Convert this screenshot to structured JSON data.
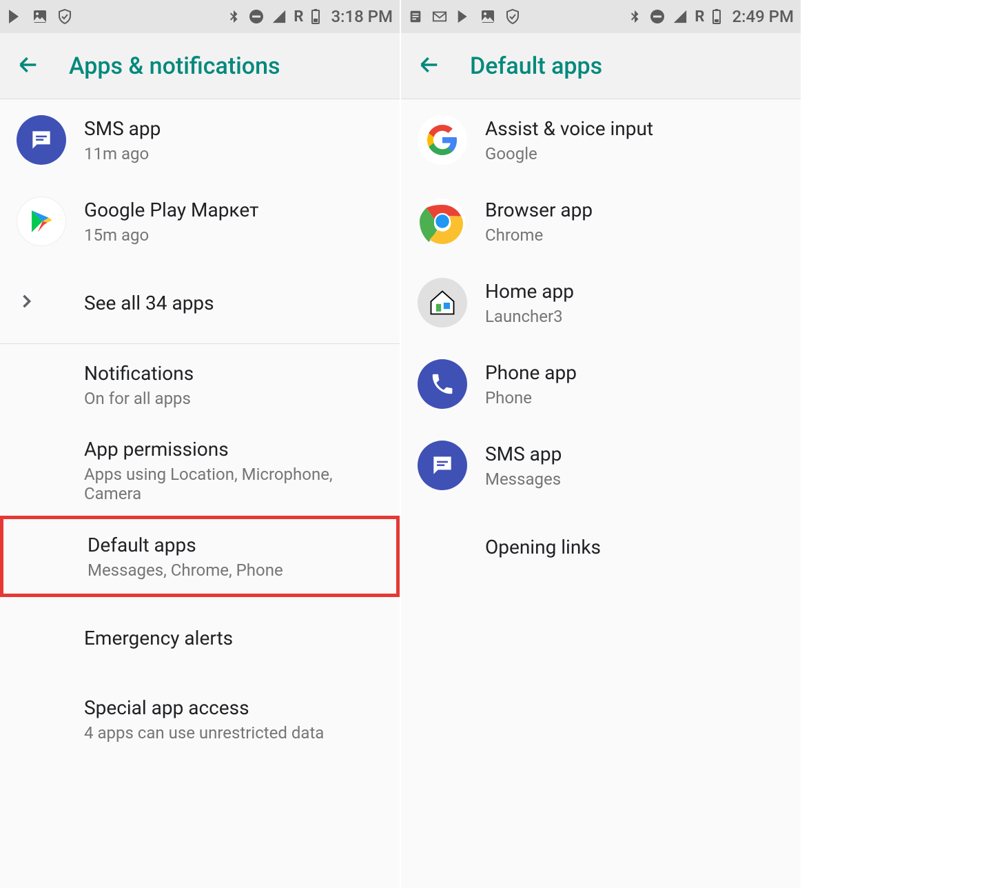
{
  "left": {
    "status": {
      "time": "3:18 PM",
      "network_label": "R"
    },
    "header": {
      "title": "Apps & notifications"
    },
    "items": [
      {
        "title": "SMS app",
        "subtitle": "11m ago"
      },
      {
        "title": "Google Play Маркет",
        "subtitle": "15m ago"
      },
      {
        "title": "See all 34 apps"
      },
      {
        "title": "Notifications",
        "subtitle": "On for all apps"
      },
      {
        "title": "App permissions",
        "subtitle": "Apps using Location, Microphone, Camera"
      },
      {
        "title": "Default apps",
        "subtitle": "Messages, Chrome, Phone"
      },
      {
        "title": "Emergency alerts"
      },
      {
        "title": "Special app access",
        "subtitle": "4 apps can use unrestricted data"
      }
    ]
  },
  "right": {
    "status": {
      "time": "2:49 PM",
      "network_label": "R"
    },
    "header": {
      "title": "Default apps"
    },
    "items": [
      {
        "title": "Assist & voice input",
        "subtitle": "Google"
      },
      {
        "title": "Browser app",
        "subtitle": "Chrome"
      },
      {
        "title": "Home app",
        "subtitle": "Launcher3"
      },
      {
        "title": "Phone app",
        "subtitle": "Phone"
      },
      {
        "title": "SMS app",
        "subtitle": "Messages"
      },
      {
        "title": "Opening links"
      }
    ]
  }
}
